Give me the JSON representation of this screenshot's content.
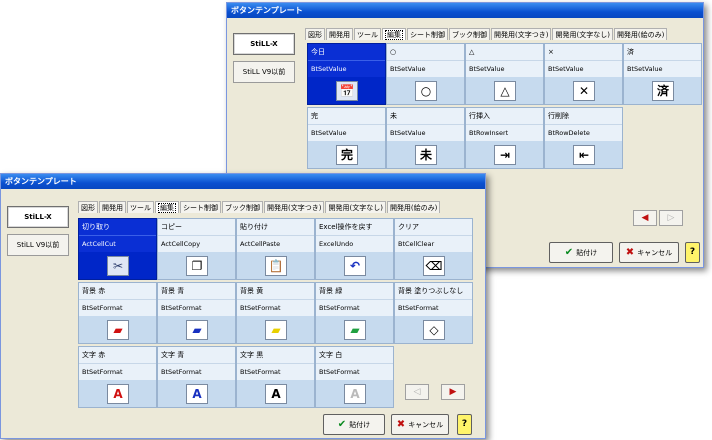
{
  "back_window": {
    "title": "ボタンテンプレート",
    "sidebar": [
      "StiLL-X",
      "StiLL V9以前"
    ],
    "tabs": [
      {
        "label": "図形",
        "state": "normal"
      },
      {
        "label": "開発用",
        "state": "normal"
      },
      {
        "label": "ツール",
        "state": "normal"
      },
      {
        "label": "編集",
        "state": "selected"
      },
      {
        "label": "シート制御",
        "state": "normal"
      },
      {
        "label": "ブック制御",
        "state": "normal"
      },
      {
        "label": "開発用(文字つき)",
        "state": "normal"
      },
      {
        "label": "開発用(文字なし)",
        "state": "normal"
      },
      {
        "label": "開発用(絵のみ)",
        "state": "normal"
      }
    ],
    "tiles": [
      {
        "name": "今日",
        "func": "BtSetValue",
        "icon": "calendar-icon",
        "glyph": "📅",
        "selected": true
      },
      {
        "name": "○",
        "func": "BtSetValue",
        "icon": "circle-icon",
        "glyph": "○",
        "selected": false
      },
      {
        "name": "△",
        "func": "BtSetValue",
        "icon": "triangle-icon",
        "glyph": "△",
        "selected": false
      },
      {
        "name": "×",
        "func": "BtSetValue",
        "icon": "cross-icon",
        "glyph": "✕",
        "selected": false
      },
      {
        "name": "済",
        "func": "BtSetValue",
        "icon": "done-kanji-icon",
        "glyph": "済",
        "selected": false
      },
      {
        "name": "完",
        "func": "BtSetValue",
        "icon": "complete-kanji-icon",
        "glyph": "完",
        "selected": false
      },
      {
        "name": "未",
        "func": "BtSetValue",
        "icon": "pending-kanji-icon",
        "glyph": "未",
        "selected": false
      },
      {
        "name": "行挿入",
        "func": "BtRowInsert",
        "icon": "row-insert-icon",
        "glyph": "⇥",
        "selected": false
      },
      {
        "name": "行削除",
        "func": "BtRowDelete",
        "icon": "row-delete-icon",
        "glyph": "⇤",
        "selected": false
      }
    ],
    "paste_label": "貼付け",
    "cancel_label": "キャンセル",
    "help_label": "?"
  },
  "front_window": {
    "title": "ボタンテンプレート",
    "sidebar": [
      "StiLL-X",
      "StiLL V9以前"
    ],
    "tabs": [
      {
        "label": "図形",
        "state": "normal"
      },
      {
        "label": "開発用",
        "state": "normal"
      },
      {
        "label": "ツール",
        "state": "normal"
      },
      {
        "label": "編集",
        "state": "selected"
      },
      {
        "label": "シート制御",
        "state": "normal"
      },
      {
        "label": "ブック制御",
        "state": "normal"
      },
      {
        "label": "開発用(文字つき)",
        "state": "normal"
      },
      {
        "label": "開発用(文字なし)",
        "state": "normal"
      },
      {
        "label": "開発用(絵のみ)",
        "state": "normal"
      }
    ],
    "tiles": [
      {
        "name": "切り取り",
        "func": "ActCellCut",
        "icon": "scissors-icon",
        "glyph": "✂",
        "selected": true
      },
      {
        "name": "コピー",
        "func": "ActCellCopy",
        "icon": "copy-icon",
        "glyph": "❐",
        "selected": false
      },
      {
        "name": "貼り付け",
        "func": "ActCellPaste",
        "icon": "paste-icon",
        "glyph": "📋",
        "selected": false
      },
      {
        "name": "Excel操作を戻す",
        "func": "ExcelUndo",
        "icon": "undo-icon",
        "glyph": "↶",
        "selected": false
      },
      {
        "name": "クリア",
        "func": "BtCellClear",
        "icon": "eraser-icon",
        "glyph": "⌫",
        "selected": false
      },
      {
        "name": "背景 赤",
        "func": "BtSetFormat",
        "icon": "fill-red-icon",
        "glyph": "▰",
        "selected": false
      },
      {
        "name": "背景 青",
        "func": "BtSetFormat",
        "icon": "fill-blue-icon",
        "glyph": "▰",
        "selected": false
      },
      {
        "name": "背景 黄",
        "func": "BtSetFormat",
        "icon": "fill-yellow-icon",
        "glyph": "▰",
        "selected": false
      },
      {
        "name": "背景 緑",
        "func": "BtSetFormat",
        "icon": "fill-green-icon",
        "glyph": "▰",
        "selected": false
      },
      {
        "name": "背景 塗りつぶしなし",
        "func": "BtSetFormat",
        "icon": "fill-none-icon",
        "glyph": "◇",
        "selected": false
      },
      {
        "name": "文字 赤",
        "func": "BtSetFormat",
        "icon": "font-red-icon",
        "glyph": "A",
        "selected": false
      },
      {
        "name": "文字 青",
        "func": "BtSetFormat",
        "icon": "font-blue-icon",
        "glyph": "A",
        "selected": false
      },
      {
        "name": "文字 黒",
        "func": "BtSetFormat",
        "icon": "font-black-icon",
        "glyph": "A",
        "selected": false
      },
      {
        "name": "文字 白",
        "func": "BtSetFormat",
        "icon": "font-white-icon",
        "glyph": "A",
        "selected": false
      }
    ],
    "paste_label": "貼付け",
    "cancel_label": "キャンセル",
    "help_label": "?"
  },
  "colors": {
    "title_bar": "#0a50d0",
    "selected_tile": "#0026c8",
    "tile": "#c6daee",
    "help_button": "#fff46a",
    "red": "#d01010",
    "blue": "#1830c0",
    "yellow": "#e8d000",
    "green": "#20a040"
  }
}
